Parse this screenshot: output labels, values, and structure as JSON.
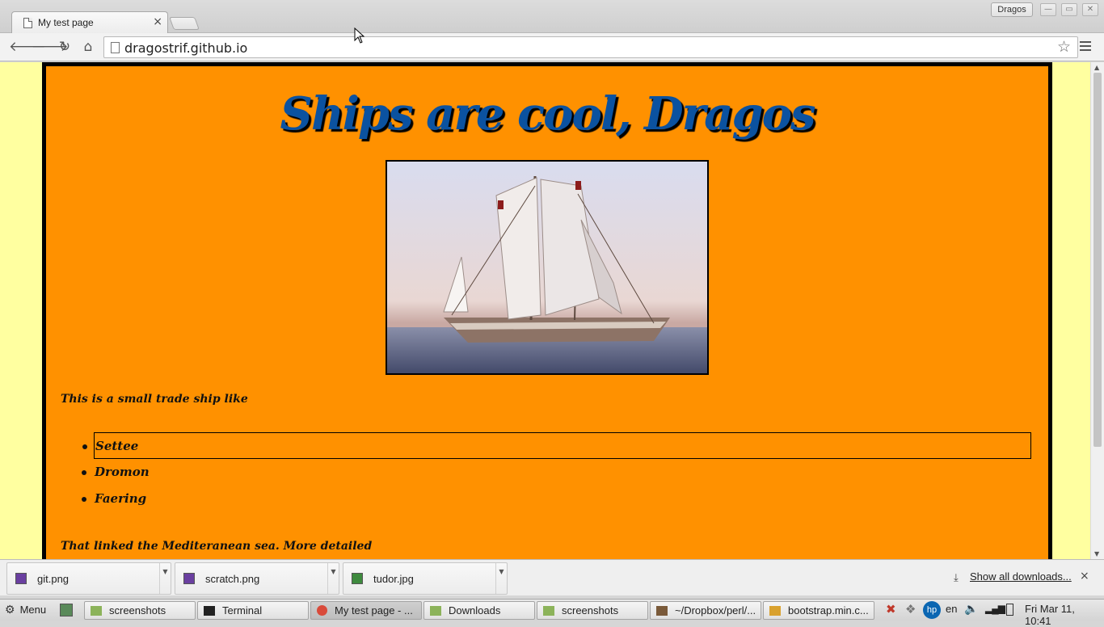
{
  "browser": {
    "tab_title": "My test page",
    "tab_close": "×",
    "profile": "Dragos",
    "url": "dragostrif.github.io"
  },
  "page": {
    "title": "Ships are cool, Dragos",
    "intro": "This is a small trade ship like",
    "ships": [
      "Settee",
      "Dromon",
      "Faering"
    ],
    "outro": "That linked the Mediteranean sea. More detailed",
    "colors": {
      "background": "#ffffa0",
      "panel": "#ff9100",
      "title": "#0b52a0"
    }
  },
  "downloads": {
    "items": [
      "git.png",
      "scratch.png",
      "tudor.jpg"
    ],
    "show_all": "Show all downloads...",
    "close": "×"
  },
  "taskbar": {
    "menu": "Menu",
    "tasks": [
      "screenshots",
      "Terminal",
      "My test page - ...",
      "Downloads",
      "screenshots",
      "~/Dropbox/perl/...",
      "bootstrap.min.c..."
    ],
    "lang": "en",
    "clock": "Fri Mar 11, 10:41"
  }
}
